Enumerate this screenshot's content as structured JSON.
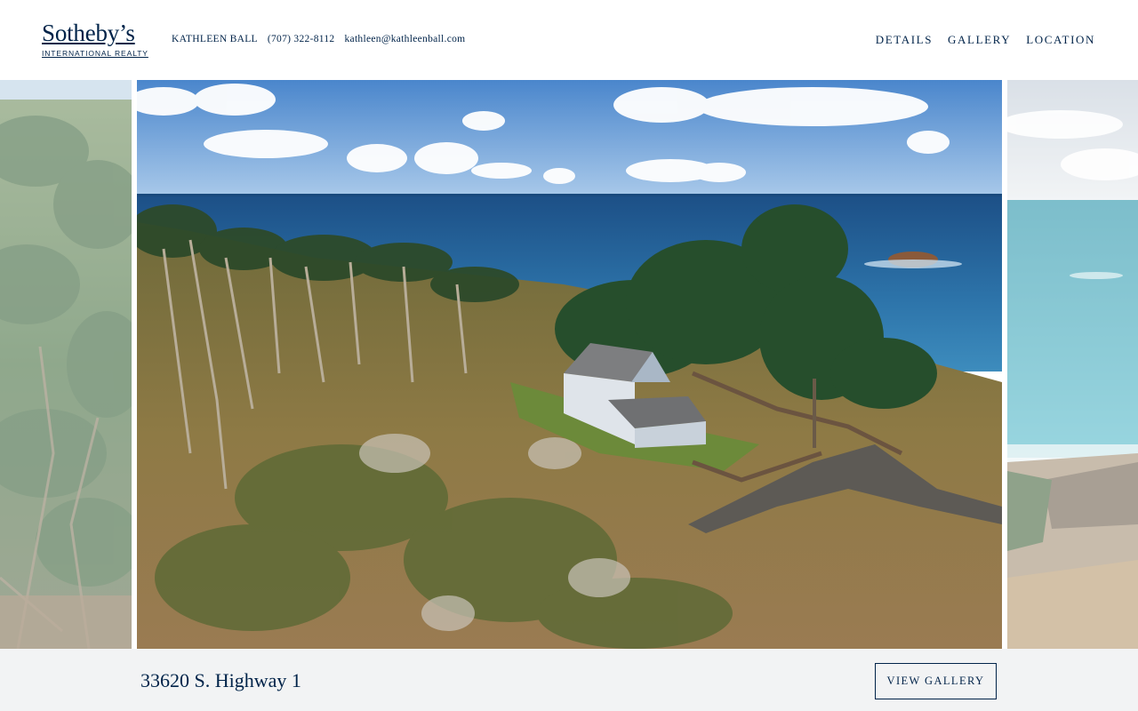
{
  "brand": {
    "name": "Sotheby’s",
    "tagline": "INTERNATIONAL REALTY"
  },
  "agent": {
    "name": "KATHLEEN BALL",
    "phone": "(707) 322-8112",
    "email": "kathleen@kathleenball.com"
  },
  "nav": {
    "details": "DETAILS",
    "gallery": "GALLERY",
    "location": "LOCATION"
  },
  "listing": {
    "address": "33620 S. Highway 1",
    "view_gallery_label": "VIEW GALLERY"
  },
  "colors": {
    "brand_navy": "#002349",
    "bar_background": "#f2f3f4"
  }
}
